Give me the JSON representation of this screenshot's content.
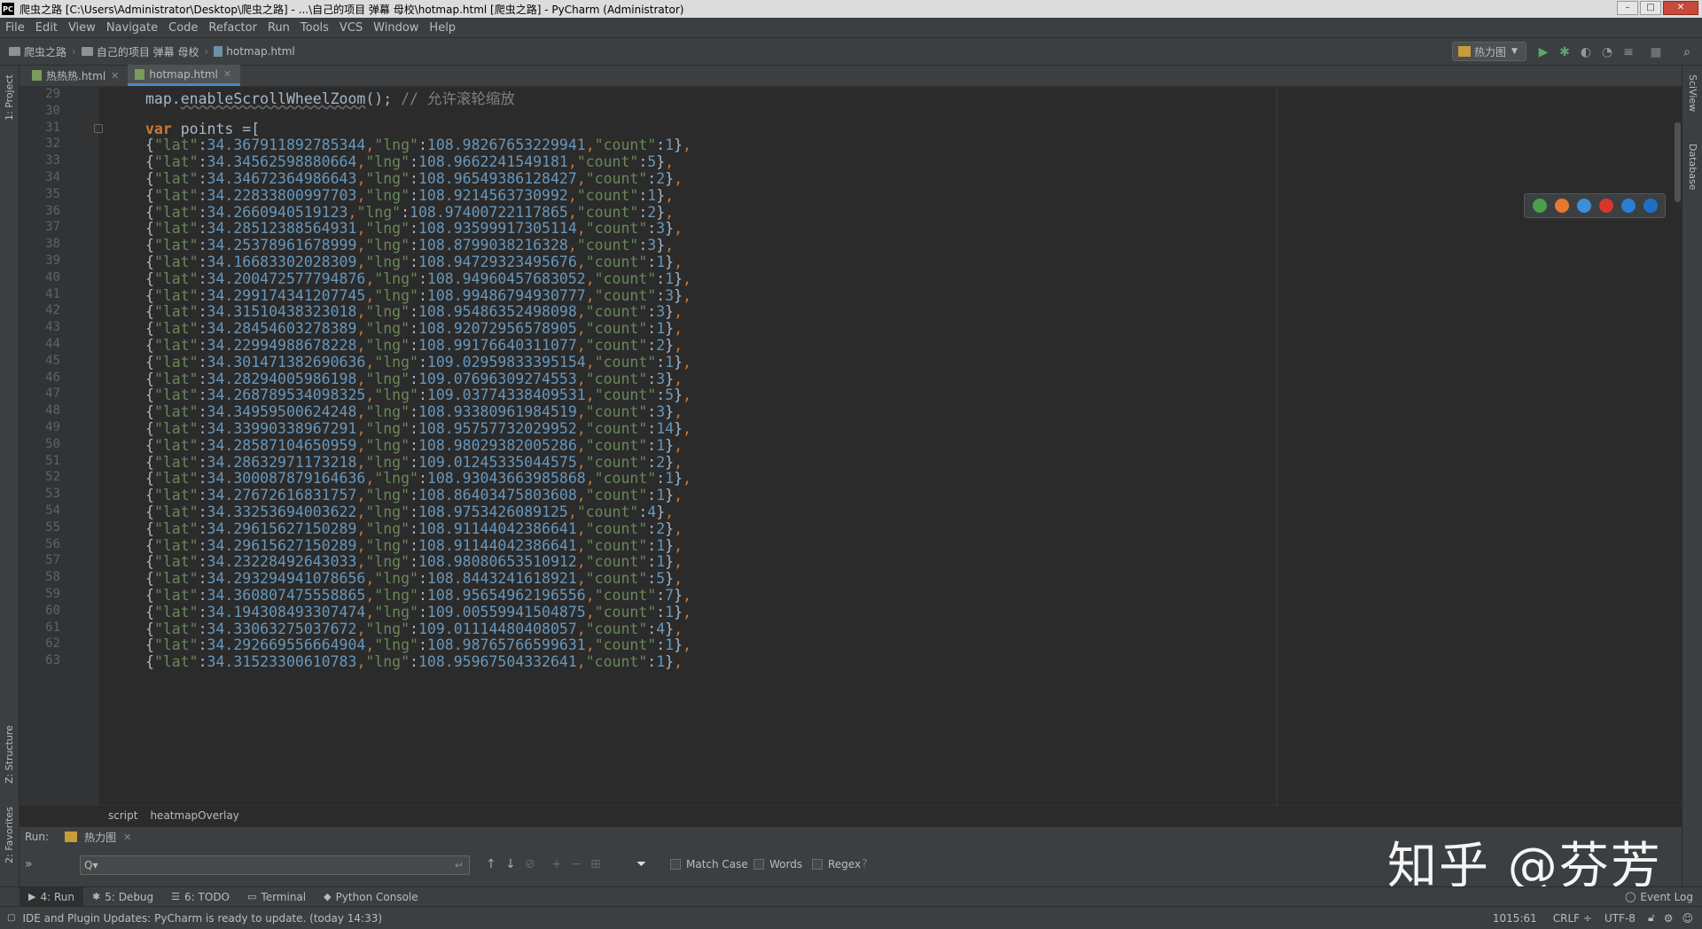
{
  "window": {
    "title": "爬虫之路 [C:\\Users\\Administrator\\Desktop\\爬虫之路] - ...\\自己的项目  弹幕  母校\\hotmap.html [爬虫之路] - PyCharm (Administrator)",
    "logo": "PC"
  },
  "menu": [
    "File",
    "Edit",
    "View",
    "Navigate",
    "Code",
    "Refactor",
    "Run",
    "Tools",
    "VCS",
    "Window",
    "Help"
  ],
  "navbar": {
    "crumbs": [
      "爬虫之路",
      "自己的项目  弹幕  母校",
      "hotmap.html"
    ],
    "run_config": "热力图"
  },
  "tabs": [
    {
      "label": "热热热.html",
      "active": false
    },
    {
      "label": "hotmap.html",
      "active": true
    }
  ],
  "left_strip": {
    "project": "1: Project",
    "structure": "Z: Structure",
    "favorites": "2: Favorites"
  },
  "right_strip": {
    "sciview": "SciView",
    "database": "Database"
  },
  "editor": {
    "line_29": "29",
    "code_29_pre": "map.",
    "code_29_fn": "enableScrollWheelZoom",
    "code_29_post": "();",
    "code_29_comment": "// 允许滚轮缩放",
    "line_30": "30",
    "line_31": "31",
    "code_31_kw": "var",
    "code_31_rest": " points =[",
    "points": [
      {
        "ln": "32",
        "lat": "34.367911892785344",
        "lng": "108.98267653229941",
        "count": "1"
      },
      {
        "ln": "33",
        "lat": "34.34562598880664",
        "lng": "108.9662241549181",
        "count": "5"
      },
      {
        "ln": "34",
        "lat": "34.34672364986643",
        "lng": "108.96549386128427",
        "count": "2"
      },
      {
        "ln": "35",
        "lat": "34.22833800997703",
        "lng": "108.9214563730992",
        "count": "1"
      },
      {
        "ln": "36",
        "lat": "34.2660940519123",
        "lng": "108.97400722117865",
        "count": "2"
      },
      {
        "ln": "37",
        "lat": "34.28512388564931",
        "lng": "108.93599917305114",
        "count": "3"
      },
      {
        "ln": "38",
        "lat": "34.25378961678999",
        "lng": "108.8799038216328",
        "count": "3"
      },
      {
        "ln": "39",
        "lat": "34.16683302028309",
        "lng": "108.94729323495676",
        "count": "1"
      },
      {
        "ln": "40",
        "lat": "34.200472577794876",
        "lng": "108.94960457683052",
        "count": "1"
      },
      {
        "ln": "41",
        "lat": "34.299174341207745",
        "lng": "108.99486794930777",
        "count": "3"
      },
      {
        "ln": "42",
        "lat": "34.31510438323018",
        "lng": "108.95486352498098",
        "count": "3"
      },
      {
        "ln": "43",
        "lat": "34.28454603278389",
        "lng": "108.92072956578905",
        "count": "1"
      },
      {
        "ln": "44",
        "lat": "34.22994988678228",
        "lng": "108.99176640311077",
        "count": "2"
      },
      {
        "ln": "45",
        "lat": "34.301471382690636",
        "lng": "109.02959833395154",
        "count": "1"
      },
      {
        "ln": "46",
        "lat": "34.28294005986198",
        "lng": "109.07696309274553",
        "count": "3"
      },
      {
        "ln": "47",
        "lat": "34.268789534098325",
        "lng": "109.03774338409531",
        "count": "5"
      },
      {
        "ln": "48",
        "lat": "34.34959500624248",
        "lng": "108.93380961984519",
        "count": "3"
      },
      {
        "ln": "49",
        "lat": "34.33990338967291",
        "lng": "108.95757732029952",
        "count": "14"
      },
      {
        "ln": "50",
        "lat": "34.28587104650959",
        "lng": "108.98029382005286",
        "count": "1"
      },
      {
        "ln": "51",
        "lat": "34.28632971173218",
        "lng": "109.01245335044575",
        "count": "2"
      },
      {
        "ln": "52",
        "lat": "34.300087879164636",
        "lng": "108.93043663985868",
        "count": "1"
      },
      {
        "ln": "53",
        "lat": "34.27672616831757",
        "lng": "108.86403475803608",
        "count": "1"
      },
      {
        "ln": "54",
        "lat": "34.33253694003622",
        "lng": "108.9753426089125",
        "count": "4"
      },
      {
        "ln": "55",
        "lat": "34.29615627150289",
        "lng": "108.91144042386641",
        "count": "2"
      },
      {
        "ln": "56",
        "lat": "34.29615627150289",
        "lng": "108.91144042386641",
        "count": "1"
      },
      {
        "ln": "57",
        "lat": "34.23228492643033",
        "lng": "108.98080653510912",
        "count": "1"
      },
      {
        "ln": "58",
        "lat": "34.293294941078656",
        "lng": "108.8443241618921",
        "count": "5"
      },
      {
        "ln": "59",
        "lat": "34.360807475558865",
        "lng": "108.95654962196556",
        "count": "7"
      },
      {
        "ln": "60",
        "lat": "34.194308493307474",
        "lng": "109.00559941504875",
        "count": "1"
      },
      {
        "ln": "61",
        "lat": "34.33063275037672",
        "lng": "109.01114480408057",
        "count": "4"
      },
      {
        "ln": "62",
        "lat": "34.292669556664904",
        "lng": "108.98765766599631",
        "count": "1"
      },
      {
        "ln": "63",
        "lat": "34.31523300610783",
        "lng": "108.95967504332641",
        "count": "1"
      }
    ]
  },
  "breadcrumb": [
    "script",
    "heatmapOverlay"
  ],
  "run_panel": {
    "label": "Run:",
    "config": "热力图",
    "search_placeholder": "Q▾",
    "match_case": "Match Case",
    "words": "Words",
    "regex": "Regex",
    "help": "?"
  },
  "tool_tabs": [
    {
      "label": "4: Run",
      "icon": "play-icon"
    },
    {
      "label": "5: Debug",
      "icon": "bug-icon"
    },
    {
      "label": "6: TODO",
      "icon": "list-icon"
    },
    {
      "label": "Terminal",
      "icon": "terminal-icon"
    },
    {
      "label": "Python Console",
      "icon": "python-icon"
    }
  ],
  "event_log": "Event Log",
  "status": {
    "message": "IDE and Plugin Updates: PyCharm is ready to update. (today 14:33)",
    "position": "1015:61",
    "line_sep": "CRLF ÷",
    "encoding": "UTF-8"
  },
  "watermark": "知乎 @芬芳",
  "colors": {
    "keyword": "#cc7832",
    "string": "#6a8759",
    "number": "#6897bb",
    "comment": "#808080",
    "background": "#2b2b2b"
  }
}
